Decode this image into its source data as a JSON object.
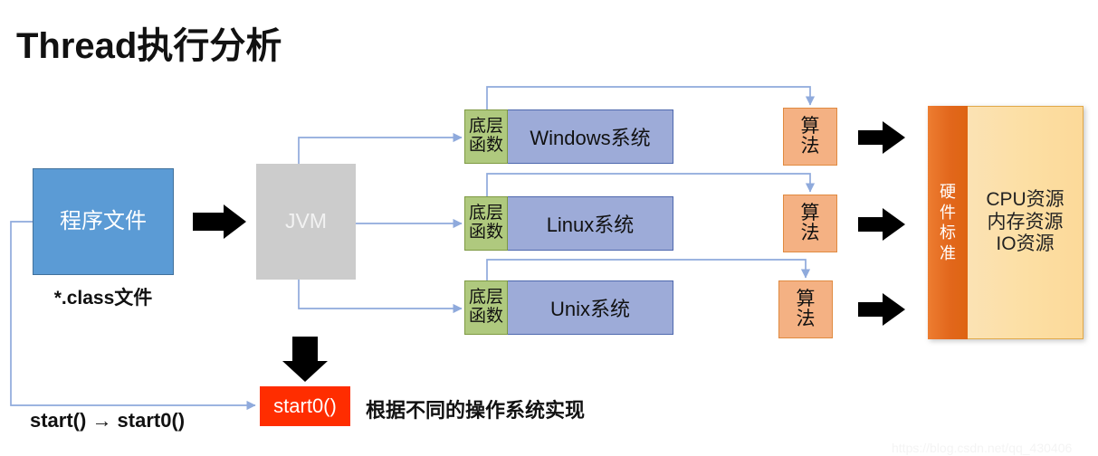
{
  "title": "Thread执行分析",
  "nodes": {
    "program_file": "程序文件",
    "class_file_label": "*.class文件",
    "jvm": "JVM",
    "func_line1": "底层",
    "func_line2": "函数",
    "algo_line1": "算",
    "algo_line2": "法",
    "start0": "start0()",
    "impl_note": "根据不同的操作系统实现",
    "start_chain": "start()  →  start0()"
  },
  "os_rows": [
    {
      "func_line1": "底层",
      "func_line2": "函数",
      "os_name": "Windows系统",
      "algo_line1": "算",
      "algo_line2": "法"
    },
    {
      "func_line1": "底层",
      "func_line2": "函数",
      "os_name": "Linux系统",
      "algo_line1": "算",
      "algo_line2": "法"
    },
    {
      "func_line1": "底层",
      "func_line2": "函数",
      "os_name": "Unix系统",
      "algo_line1": "算",
      "algo_line2": "法"
    }
  ],
  "hardware": {
    "standard_c1": "硬",
    "standard_c2": "件",
    "standard_c3": "标",
    "standard_c4": "准",
    "resource_line1": "CPU资源",
    "resource_line2": "内存资源",
    "resource_line3": "IO资源"
  },
  "watermark": "https://blog.csdn.net/qq_430406",
  "colors": {
    "program_file_fill": "#5B9BD5",
    "jvm_fill": "#CCCCCC",
    "func_fill": "#AFC97E",
    "os_fill": "#9DABD8",
    "algo_fill": "#F4B183",
    "hardware_strip_fill": "#ED7D31",
    "resource_fill": "#FBE2B4",
    "start0_fill": "#FF2D00",
    "connector_stroke": "#8FAADC",
    "black_arrow": "#000000",
    "background": "#FFFFFF"
  }
}
